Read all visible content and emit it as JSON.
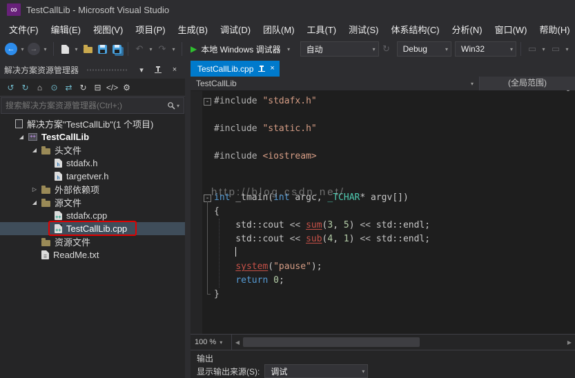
{
  "window": {
    "title": "TestCallLib - Microsoft Visual Studio"
  },
  "menu": {
    "items": [
      "文件(F)",
      "编辑(E)",
      "视图(V)",
      "项目(P)",
      "生成(B)",
      "调试(D)",
      "团队(M)",
      "工具(T)",
      "测试(S)",
      "体系结构(C)",
      "分析(N)",
      "窗口(W)",
      "帮助(H)"
    ]
  },
  "toolbar": {
    "run_label": "本地 Windows 调试器",
    "auto_value": "自动",
    "config_value": "Debug",
    "platform_value": "Win32"
  },
  "solution_explorer": {
    "title": "解决方案资源管理器",
    "search_placeholder": "搜索解决方案资源管理器(Ctrl+;)",
    "toolbar_icons": [
      {
        "name": "nav-back-icon",
        "glyph": "↺",
        "color": "#6fb8c9"
      },
      {
        "name": "nav-forward-icon",
        "glyph": "↻",
        "color": "#6fb8c9"
      },
      {
        "name": "home-icon",
        "glyph": "⌂",
        "color": "#d0d0d0"
      },
      {
        "name": "switch-views-icon",
        "glyph": "⊙",
        "color": "#6fb8c9"
      },
      {
        "name": "sync-with-active-document-icon",
        "glyph": "⇄",
        "color": "#6fb8c9"
      },
      {
        "name": "refresh-icon",
        "glyph": "↻",
        "color": "#d0d0d0"
      },
      {
        "name": "collapse-all-icon",
        "glyph": "⊟",
        "color": "#d0d0d0"
      },
      {
        "name": "view-code-icon",
        "glyph": "</>",
        "color": "#d0d0d0"
      },
      {
        "name": "properties-icon",
        "glyph": "⚙",
        "color": "#d0d0d0"
      }
    ],
    "tree": [
      {
        "id": "solution",
        "level": 0,
        "icon": "solution",
        "label": "解决方案\"TestCallLib\"(1 个项目)"
      },
      {
        "id": "project-testcalllib",
        "level": 1,
        "icon": "project",
        "badge": "++",
        "label": "TestCallLib",
        "arrow": "expanded",
        "bold": true
      },
      {
        "id": "folder-headers",
        "level": 2,
        "icon": "folder",
        "label": "头文件",
        "arrow": "expanded"
      },
      {
        "id": "file-stdafx-h",
        "level": 3,
        "icon": "file-h",
        "badge": "h",
        "label": "stdafx.h"
      },
      {
        "id": "file-targetver-h",
        "level": 3,
        "icon": "file-h",
        "badge": "h",
        "label": "targetver.h"
      },
      {
        "id": "folder-external-dependencies",
        "level": 2,
        "icon": "folder",
        "label": "外部依赖项",
        "arrow": "collapsed"
      },
      {
        "id": "folder-sources",
        "level": 2,
        "icon": "folder",
        "label": "源文件",
        "arrow": "expanded"
      },
      {
        "id": "file-stdafx-cpp",
        "level": 3,
        "icon": "file-cpp",
        "badge": "++",
        "label": "stdafx.cpp"
      },
      {
        "id": "file-testcalllib-cpp",
        "level": 3,
        "icon": "file-cpp",
        "badge": "++",
        "label": "TestCallLib.cpp",
        "selected": true,
        "annotated": true
      },
      {
        "id": "folder-resources",
        "level": 2,
        "icon": "folder",
        "label": "资源文件"
      },
      {
        "id": "file-readme-txt",
        "level": 2,
        "icon": "file-txt",
        "badge": "≡",
        "label": "ReadMe.txt"
      }
    ]
  },
  "editor": {
    "tab": "TestCallLib.cpp",
    "nav_type": "TestCallLib",
    "nav_scope": "(全局范围)",
    "zoom": "100 %",
    "watermark": "http://blog.csdn.net/",
    "outline": {
      "from": 8,
      "to": 15
    },
    "indent_guide": {
      "from": 10,
      "to": 15
    },
    "code": [
      {
        "fold": true,
        "s": [
          {
            "c": "pre",
            "t": "#include "
          },
          {
            "c": "str",
            "t": "\"stdafx.h\""
          }
        ]
      },
      {
        "s": []
      },
      {
        "s": [
          {
            "c": "pre",
            "t": "#include "
          },
          {
            "c": "str",
            "t": "\"static.h\""
          }
        ]
      },
      {
        "s": []
      },
      {
        "s": [
          {
            "c": "pre",
            "t": "#include "
          },
          {
            "c": "str",
            "t": "<iostream>"
          }
        ]
      },
      {
        "s": []
      },
      {
        "s": []
      },
      {
        "fold": true,
        "s": [
          {
            "c": "kw",
            "t": "int"
          },
          {
            "c": "pln",
            "t": " _tmain("
          },
          {
            "c": "kw",
            "t": "int"
          },
          {
            "c": "pln",
            "t": " argc, "
          },
          {
            "c": "typ",
            "t": "_TCHAR"
          },
          {
            "c": "pln",
            "t": "* argv[])"
          }
        ]
      },
      {
        "s": [
          {
            "c": "pln",
            "t": "{"
          }
        ]
      },
      {
        "s": [
          {
            "c": "pln",
            "t": "    std::cout "
          },
          {
            "c": "op",
            "t": "<< "
          },
          {
            "c": "err",
            "t": "sum"
          },
          {
            "c": "pln",
            "t": "("
          },
          {
            "c": "num",
            "t": "3"
          },
          {
            "c": "pln",
            "t": ", "
          },
          {
            "c": "num",
            "t": "5"
          },
          {
            "c": "pln",
            "t": ") "
          },
          {
            "c": "op",
            "t": "<< "
          },
          {
            "c": "pln",
            "t": "std::endl;"
          }
        ]
      },
      {
        "s": [
          {
            "c": "pln",
            "t": "    std::cout "
          },
          {
            "c": "op",
            "t": "<< "
          },
          {
            "c": "err",
            "t": "sub"
          },
          {
            "c": "pln",
            "t": "("
          },
          {
            "c": "num",
            "t": "4"
          },
          {
            "c": "pln",
            "t": ", "
          },
          {
            "c": "num",
            "t": "1"
          },
          {
            "c": "pln",
            "t": ") "
          },
          {
            "c": "op",
            "t": "<< "
          },
          {
            "c": "pln",
            "t": "std::endl;"
          }
        ]
      },
      {
        "cursor": true,
        "s": [
          {
            "c": "pln",
            "t": "    "
          }
        ]
      },
      {
        "s": [
          {
            "c": "pln",
            "t": "    "
          },
          {
            "c": "err",
            "t": "system"
          },
          {
            "c": "pln",
            "t": "("
          },
          {
            "c": "str",
            "t": "\"pause\""
          },
          {
            "c": "pln",
            "t": ");"
          }
        ]
      },
      {
        "s": [
          {
            "c": "pln",
            "t": "    "
          },
          {
            "c": "kw",
            "t": "return"
          },
          {
            "c": "pln",
            "t": " "
          },
          {
            "c": "num",
            "t": "0"
          },
          {
            "c": "pln",
            "t": ";"
          }
        ]
      },
      {
        "s": [
          {
            "c": "pln",
            "t": "}"
          }
        ]
      }
    ]
  },
  "output": {
    "title": "输出",
    "source_label": "显示输出来源(S):",
    "source_value": "调试"
  },
  "colors": {
    "accent": "#007acc",
    "selection": "#3f4d5a",
    "annotation": "#e00000",
    "error_token": "#c75148"
  },
  "icons": {
    "fold": "-",
    "expanded": "◢",
    "collapsed": "▷",
    "caret": "▾",
    "close": "×",
    "play": "▶",
    "back": "←",
    "forward": "→",
    "undo": "↶",
    "redo": "↷",
    "refresh": "↻",
    "scroll_left": "◀",
    "scroll_right": "▶"
  }
}
